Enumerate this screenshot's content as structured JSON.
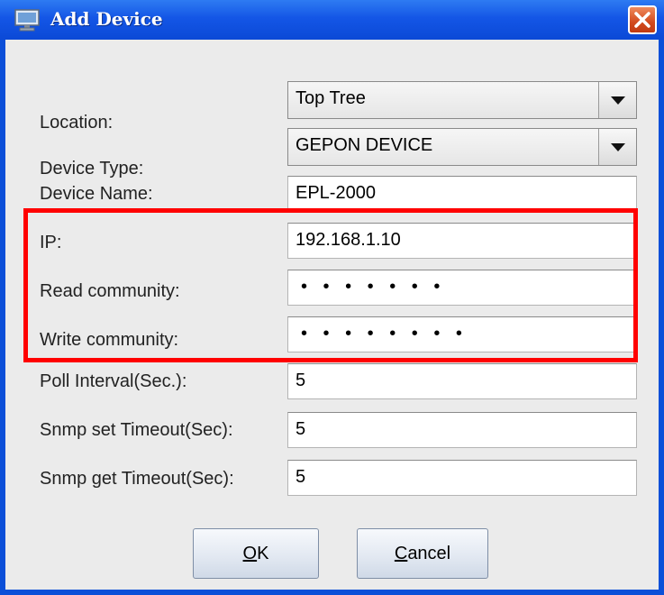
{
  "window": {
    "title": "Add Device",
    "icon": "computer-icon",
    "close_icon": "close-icon"
  },
  "form": {
    "location": {
      "label": "Location:",
      "value": "Top Tree"
    },
    "device_type": {
      "label": "Device Type:",
      "value": "GEPON DEVICE"
    },
    "device_name": {
      "label": "Device Name:",
      "value": "EPL-2000"
    },
    "ip": {
      "label": "IP:",
      "value": "192.168.1.10"
    },
    "read_community": {
      "label": "Read community:",
      "value": "• • • • • • •"
    },
    "write_community": {
      "label": "Write community:",
      "value": "• • • • • • • •"
    },
    "poll_interval": {
      "label": "Poll Interval(Sec.):",
      "value": "5"
    },
    "snmp_set_timeout": {
      "label": "Snmp set Timeout(Sec):",
      "value": "5"
    },
    "snmp_get_timeout": {
      "label": "Snmp get Timeout(Sec):",
      "value": "5"
    }
  },
  "buttons": {
    "ok_mnemonic": "O",
    "ok_rest": "K",
    "cancel_mnemonic": "C",
    "cancel_rest": "ancel"
  },
  "colors": {
    "highlight": "#ff0000",
    "titlebar": "#1456e6",
    "close_button": "#d24a1e"
  }
}
